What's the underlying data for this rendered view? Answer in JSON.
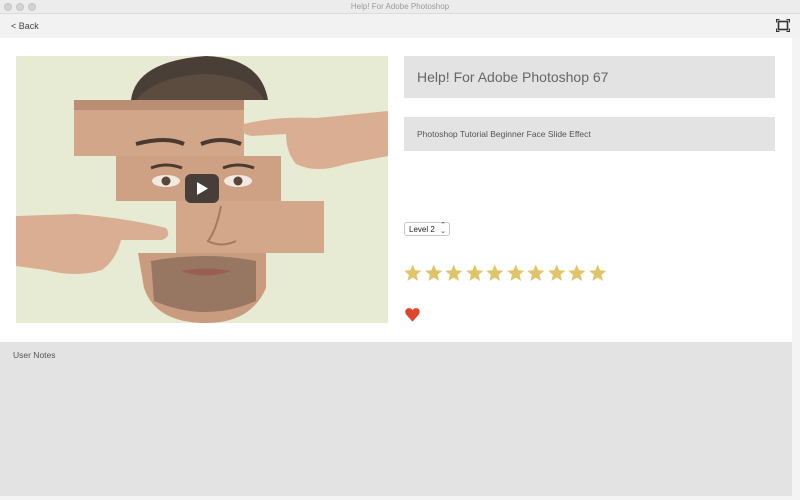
{
  "window": {
    "title": "Help! For Adobe Photoshop"
  },
  "toolbar": {
    "back_label": "< Back",
    "fullscreen_icon": "fullscreen-icon"
  },
  "video": {
    "thumbnail_icon": "face-slide-thumbnail",
    "play_icon": "play-icon"
  },
  "lesson": {
    "title": "Help! For Adobe Photoshop 67",
    "description": "Photoshop Tutorial Beginner Face Slide Effect",
    "level": {
      "selected": "Level 2"
    },
    "rating": {
      "stars": 10,
      "color": "#e1c46a"
    },
    "favorite": {
      "icon": "heart-icon",
      "color": "#e0452c"
    }
  },
  "notes": {
    "label": "User Notes"
  }
}
